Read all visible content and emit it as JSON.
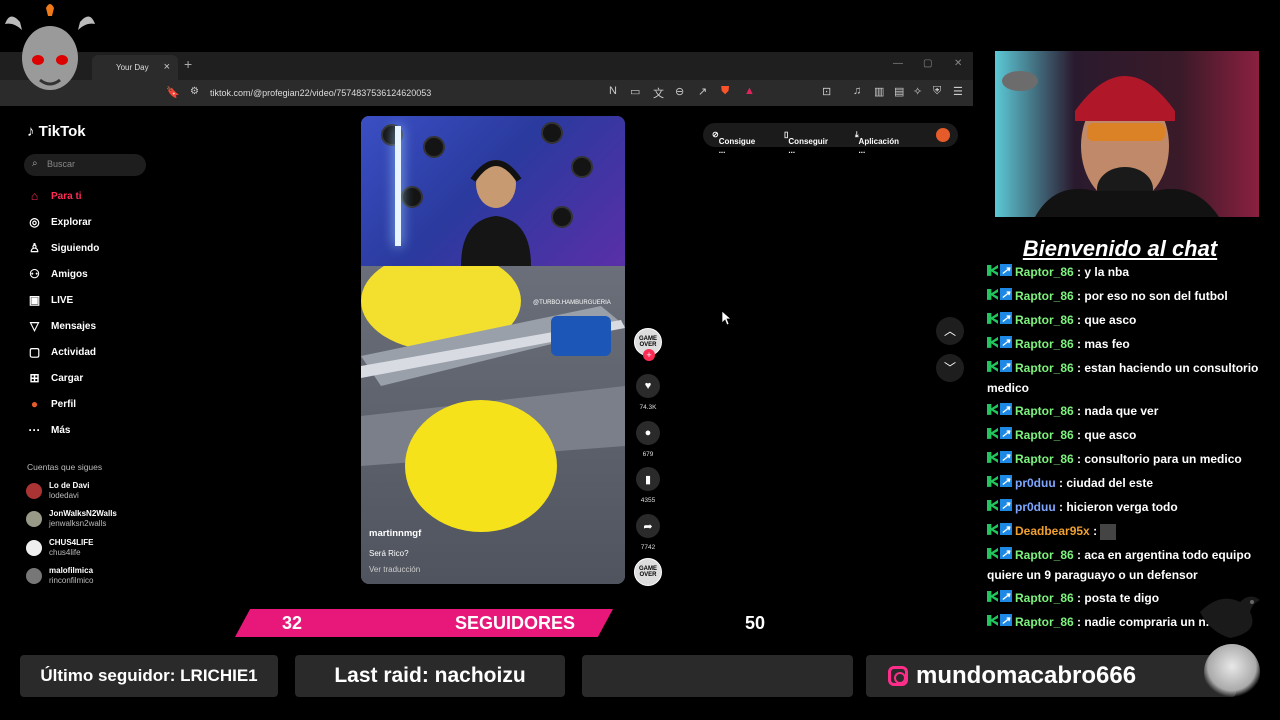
{
  "browser": {
    "tab_label": "Your Day",
    "url": "tiktok.com/@profegian22/video/7574837536124620053"
  },
  "tiktok": {
    "logo": "TikTok",
    "search_placeholder": "Buscar",
    "nav": [
      {
        "label": "Para ti",
        "icon": "home-icon"
      },
      {
        "label": "Explorar",
        "icon": "compass-icon"
      },
      {
        "label": "Siguiendo",
        "icon": "following-icon"
      },
      {
        "label": "Amigos",
        "icon": "friends-icon"
      },
      {
        "label": "LIVE",
        "icon": "live-icon"
      },
      {
        "label": "Mensajes",
        "icon": "inbox-icon",
        "badge": "1"
      },
      {
        "label": "Actividad",
        "icon": "activity-icon"
      },
      {
        "label": "Cargar",
        "icon": "upload-icon"
      },
      {
        "label": "Perfil",
        "icon": "profile-icon"
      },
      {
        "label": "Más",
        "icon": "more-icon"
      }
    ],
    "following_heading": "Cuentas que sigues",
    "following": [
      {
        "name": "Lo de Davi",
        "handle": "lodedavi"
      },
      {
        "name": "JonWalksN2Walls",
        "handle": "jenwalksn2walls"
      },
      {
        "name": "CHUS4LIFE",
        "handle": "chus4life"
      },
      {
        "name": "malofilmica",
        "handle": "rinconfilmico"
      }
    ],
    "video": {
      "watermark": "@TURBO.HAMBURGUERIA",
      "username": "martinnmgf",
      "caption": "Será Rico?",
      "translate": "Ver traducción"
    },
    "rail": {
      "avatar_text": "GAME OVER",
      "likes": "74.3K",
      "comments": "679",
      "saves": "4355",
      "shares": "7742"
    },
    "promo": {
      "item1": "Consigue ...",
      "item2": "Conseguir ...",
      "item3": "Aplicación ..."
    }
  },
  "chat": {
    "title": "Bienvenido al chat",
    "messages": [
      {
        "user": "Raptor_86",
        "text": ": y la nba",
        "color": "green"
      },
      {
        "user": "Raptor_86",
        "text": ": por eso no son del futbol",
        "color": "green"
      },
      {
        "user": "Raptor_86",
        "text": ": que asco",
        "color": "green"
      },
      {
        "user": "Raptor_86",
        "text": ": mas feo",
        "color": "green"
      },
      {
        "user": "Raptor_86",
        "text": ": estan haciendo un consultorio medico",
        "color": "green"
      },
      {
        "user": "Raptor_86",
        "text": ": nada que ver",
        "color": "green"
      },
      {
        "user": "Raptor_86",
        "text": ": que asco",
        "color": "green"
      },
      {
        "user": "Raptor_86",
        "text": ": consultorio para un medico",
        "color": "green"
      },
      {
        "user": "pr0duu",
        "text": ": ciudad del este",
        "color": "blue"
      },
      {
        "user": "pr0duu",
        "text": ": hicieron verga todo",
        "color": "blue"
      },
      {
        "user": "Deadbear95x",
        "text": ":",
        "color": "orange"
      },
      {
        "user": "Raptor_86",
        "text": ": aca en argentina todo equipo quiere un 9 paraguayo o un defensor",
        "color": "green"
      },
      {
        "user": "Raptor_86",
        "text": ": posta te digo",
        "color": "green"
      },
      {
        "user": "Raptor_86",
        "text": ": nadie compraria un n...",
        "color": "green"
      }
    ]
  },
  "overlay": {
    "followers_count": "32",
    "followers_label": "SEGUIDORES",
    "followers_goal": "50",
    "last_follower": "Último seguidor: LRICHIE1",
    "last_raid": "Last raid: nachoizu",
    "empty_panel": "",
    "instagram": "mundomacabro666"
  }
}
